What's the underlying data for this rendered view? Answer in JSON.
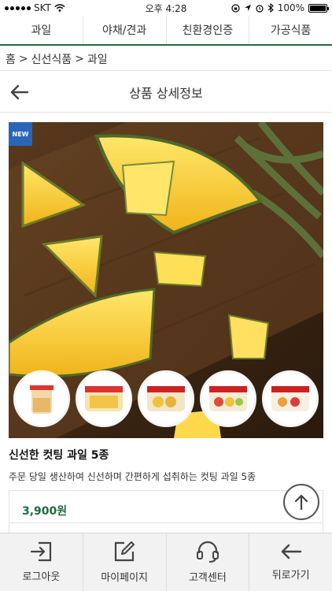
{
  "status": {
    "carrier": "SKT",
    "time": "오후 4:28",
    "battery": "100%"
  },
  "category_tabs": [
    "과일",
    "야채/견과",
    "친환경인증",
    "가공식품"
  ],
  "breadcrumb": [
    "홈",
    "신선식품",
    "과일"
  ],
  "header": {
    "title": "상품 상세정보"
  },
  "product": {
    "badge": "NEW",
    "name": "신선한 컷팅 과일 5종",
    "description": "주문 당일 생산하여 신선하며 간편하게 섭취하는 컷팅 과일 5종",
    "price": "3,900원"
  },
  "bottom_nav": [
    {
      "label": "로그아웃",
      "icon": "logout-icon"
    },
    {
      "label": "마이페이지",
      "icon": "edit-icon"
    },
    {
      "label": "고객센터",
      "icon": "headset-icon"
    },
    {
      "label": "뒤로가기",
      "icon": "back-arrow-icon"
    }
  ],
  "colors": {
    "accent_green": "#1f6b3f",
    "badge_blue": "#2a66b8"
  }
}
